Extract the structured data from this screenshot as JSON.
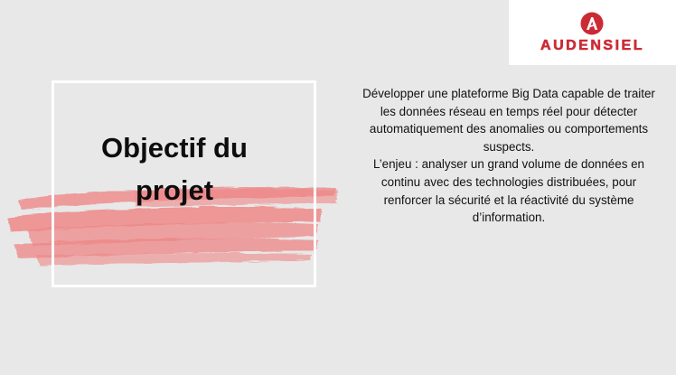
{
  "logo": {
    "brand_name": "AUDENSIEL",
    "icon": "audensiel-a-logo-icon",
    "brand_color": "#cc2b35"
  },
  "title": {
    "line1": "Objectif du",
    "line2": "projet"
  },
  "description": {
    "paragraph1": "Développer une plateforme Big Data capable de traiter les données réseau en temps réel pour détecter automatiquement des anomalies ou comportements suspects.",
    "paragraph2": "L’enjeu : analyser un grand volume de données en continu avec des technologies distribuées, pour renforcer la sécurité et la réactivité du système d’information."
  },
  "colors": {
    "background": "#e8e8e8",
    "brush": "#ee8585",
    "frame": "#ffffff"
  }
}
